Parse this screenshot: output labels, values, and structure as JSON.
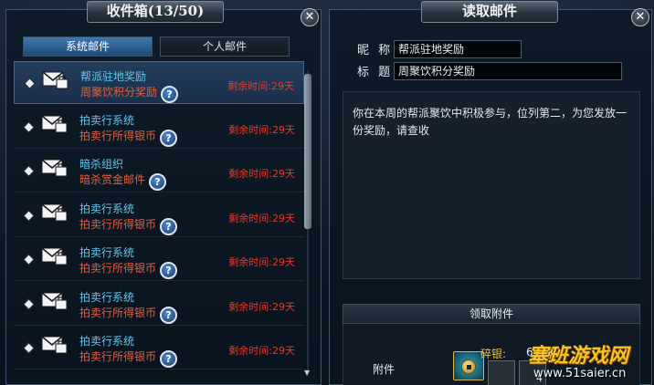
{
  "inbox": {
    "title": "收件箱(13/50)",
    "tabs": [
      {
        "label": "系统邮件",
        "active": true
      },
      {
        "label": "个人邮件",
        "active": false
      }
    ],
    "mails": [
      {
        "sender": "帮派驻地奖励",
        "subject": "周聚饮积分奖励",
        "remaining": "剩余时间:29天",
        "selected": true
      },
      {
        "sender": "拍卖行系统",
        "subject": "拍卖行所得银币",
        "remaining": "剩余时间:29天",
        "selected": false
      },
      {
        "sender": "暗杀组织",
        "subject": "暗杀赏金邮件",
        "remaining": "剩余时间:29天",
        "selected": false
      },
      {
        "sender": "拍卖行系统",
        "subject": "拍卖行所得银币",
        "remaining": "剩余时间:29天",
        "selected": false
      },
      {
        "sender": "拍卖行系统",
        "subject": "拍卖行所得银币",
        "remaining": "剩余时间:29天",
        "selected": false
      },
      {
        "sender": "拍卖行系统",
        "subject": "拍卖行所得银币",
        "remaining": "剩余时间:29天",
        "selected": false
      },
      {
        "sender": "拍卖行系统",
        "subject": "拍卖行所得银币",
        "remaining": "剩余时间:29天",
        "selected": false
      }
    ]
  },
  "reader": {
    "title": "读取邮件",
    "nickname_label": "昵 称",
    "nickname_value": "帮派驻地奖励",
    "subject_label": "标 题",
    "subject_value": "周聚饮积分奖励",
    "body": "你在本周的帮派聚饮中积极参与，位列第二，为您发放一份奖励，请查收",
    "claim_label": "领取附件",
    "attachment_label": "附件",
    "money_label": "碎银:",
    "money_value": "60",
    "slot_count": "4"
  },
  "watermark": {
    "logo_text": "塞班游戏网",
    "url": "www.51saier.cn"
  },
  "colors": {
    "sender": "#5fc8f0",
    "subject": "#e2603f",
    "remaining": "#e83a2c",
    "tab_active": "#2f6396"
  }
}
